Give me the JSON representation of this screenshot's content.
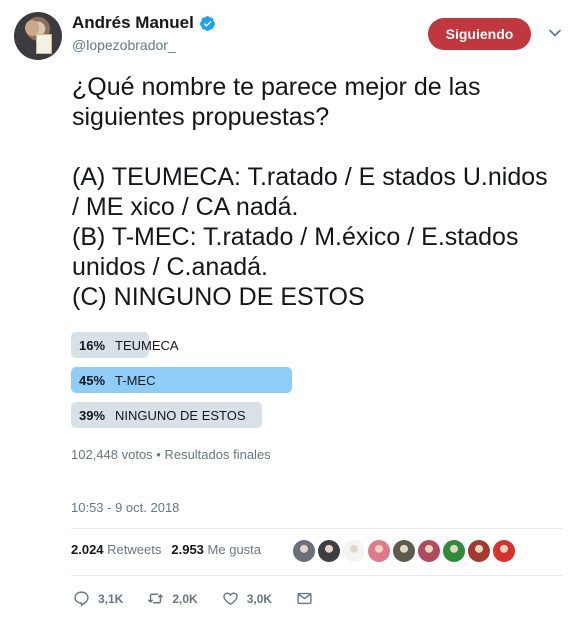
{
  "user": {
    "display_name": "Andrés Manuel",
    "handle": "@lopezobrador_",
    "follow_label": "Siguiendo"
  },
  "tweet": {
    "lines": [
      "¿Qué nombre te parece mejor de las",
      "siguientes propuestas?",
      "",
      "(A) TEUMECA: T.ratado / E stados U.nidos",
      "/ ME xico / CA nadá.",
      "(B) T-MEC: T.ratado / M.éxico / E.stados",
      "unidos / C.anadá.",
      "(C) NINGUNO DE ESTOS"
    ]
  },
  "poll": {
    "options": [
      {
        "percent": 16,
        "percent_label": "16%",
        "label": "TEUMECA",
        "winner": false
      },
      {
        "percent": 45,
        "percent_label": "45%",
        "label": "T-MEC",
        "winner": true
      },
      {
        "percent": 39,
        "percent_label": "39%",
        "label": "NINGUNO DE ESTOS",
        "winner": false
      }
    ],
    "meta": "102,448 votos • Resultados finales"
  },
  "timestamp": "10:53 - 9 oct. 2018",
  "stats": {
    "retweets_count": "2.024",
    "retweets_label": "Retweets",
    "likes_count": "2.953",
    "likes_label": "Me gusta"
  },
  "likers": [
    {
      "name": "liker-1",
      "color": "#6b6f7a"
    },
    {
      "name": "liker-2",
      "color": "#3d3d45"
    },
    {
      "name": "liker-3",
      "color": "#f4f4f4"
    },
    {
      "name": "liker-4",
      "color": "#e07a8a"
    },
    {
      "name": "liker-5",
      "color": "#5b5c4e"
    },
    {
      "name": "liker-6",
      "color": "#b04a5c"
    },
    {
      "name": "liker-7",
      "color": "#2f8a3a"
    },
    {
      "name": "liker-8",
      "color": "#a33a2c"
    },
    {
      "name": "liker-9",
      "color": "#d8322c"
    }
  ],
  "actions": {
    "reply_count": "3,1K",
    "retweet_count": "2,0K",
    "like_count": "3,0K"
  },
  "colors": {
    "follow_button": "#c0373d",
    "poll_winner": "#8ecdf8",
    "poll_other": "#d8e1e8",
    "verified": "#1da1f2",
    "muted_text": "#657786"
  }
}
